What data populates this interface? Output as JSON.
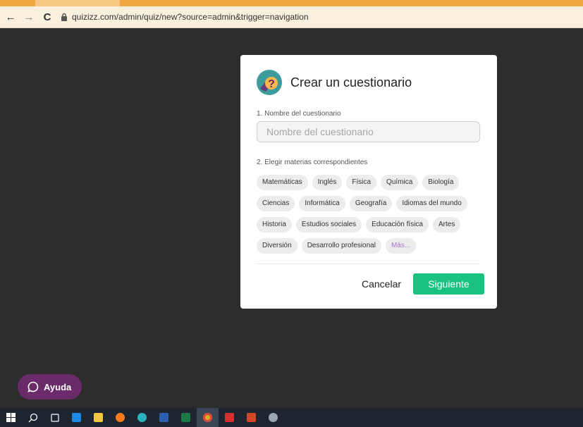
{
  "browser": {
    "url": "quizizz.com/admin/quiz/new?source=admin&trigger=navigation",
    "icons": [
      "back-arrow-icon",
      "forward-arrow-icon",
      "reload-icon",
      "lock-icon"
    ]
  },
  "modal": {
    "title": "Crear un cuestionario",
    "name_label": "1. Nombre del cuestionario",
    "name_placeholder": "Nombre del cuestionario",
    "name_value": "",
    "subjects_label": "2. Elegir materias correspondientes",
    "subject_rows": [
      [
        "Matemáticas",
        "Inglés",
        "Física",
        "Química",
        "Biología"
      ],
      [
        "Ciencias",
        "Informática",
        "Geografía",
        "Idiomas del mundo"
      ],
      [
        "Historia",
        "Estudios sociales",
        "Educación física",
        "Artes"
      ],
      [
        "Diversión",
        "Desarrollo profesional",
        "Más..."
      ]
    ],
    "cancel_label": "Cancelar",
    "next_label": "Siguiente"
  },
  "help_button": {
    "label": "Ayuda"
  },
  "colors": {
    "accent_green": "#19c27f",
    "help_purple": "#6b2a69",
    "more_chip_text": "#a878c8"
  },
  "taskbar": {
    "icons": [
      "windows-start-icon",
      "search-icon",
      "task-view-icon",
      "media-app-icon",
      "file-explorer-icon",
      "firefox-icon",
      "edge-icon",
      "word-icon",
      "excel-icon",
      "chrome-icon",
      "acrobat-icon",
      "powerpoint-icon",
      "paint-icon"
    ]
  }
}
